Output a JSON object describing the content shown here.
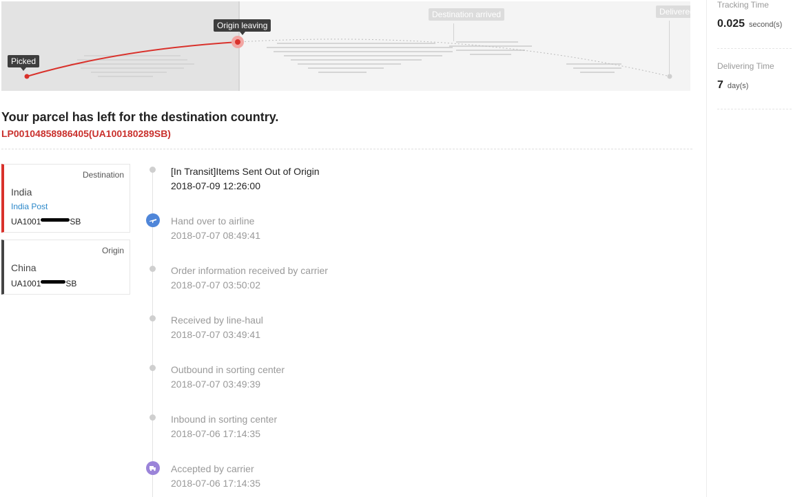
{
  "progress": {
    "stages": {
      "picked": "Picked",
      "origin_leaving": "Origin leaving",
      "destination_arrived": "Destination arrived",
      "delivered": "Delivered"
    },
    "colors": {
      "done": "#d9312b",
      "pending": "#c8c8c8"
    }
  },
  "stats": {
    "tracking_time": {
      "label": "Tracking Time",
      "value": "0.025",
      "unit": "second(s)"
    },
    "delivering_time": {
      "label": "Delivering Time",
      "value": "7",
      "unit": "day(s)"
    }
  },
  "status": {
    "headline": "Your parcel has left for the destination country.",
    "tracking_number": "LP00104858986405(UA100180289SB)"
  },
  "destination": {
    "role": "Destination",
    "country": "India",
    "carrier": "India Post",
    "number_prefix": "UA1001",
    "number_suffix": "SB"
  },
  "origin": {
    "role": "Origin",
    "country": "China",
    "number_prefix": "UA1001",
    "number_suffix": "SB"
  },
  "events": [
    {
      "title": "[In Transit]Items Sent Out of Origin",
      "time": "2018-07-09 12:26:00",
      "icon": "dot",
      "current": true
    },
    {
      "title": "Hand over to airline",
      "time": "2018-07-07 08:49:41",
      "icon": "airplane-icon",
      "color": "#4f86d9"
    },
    {
      "title": "Order information received by carrier",
      "time": "2018-07-07 03:50:02",
      "icon": "dot"
    },
    {
      "title": "Received by line-haul",
      "time": "2018-07-07 03:49:41",
      "icon": "dot"
    },
    {
      "title": "Outbound in sorting center",
      "time": "2018-07-07 03:49:39",
      "icon": "dot"
    },
    {
      "title": "Inbound in sorting center",
      "time": "2018-07-06 17:14:35",
      "icon": "dot"
    },
    {
      "title": "Accepted by carrier",
      "time": "2018-07-06 17:14:35",
      "icon": "truck-icon",
      "color": "#9b84d9"
    }
  ]
}
